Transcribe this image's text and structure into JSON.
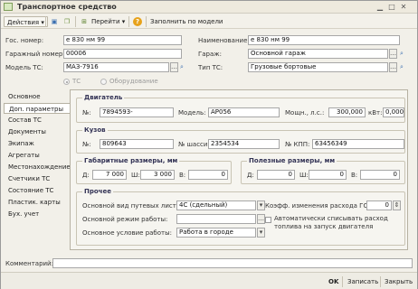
{
  "window": {
    "title": "Транспортное средство"
  },
  "toolbar": {
    "actions_label": "Действия",
    "goto_label": "Перейти",
    "help_label": "?",
    "fill_label": "Заполнить по модели"
  },
  "header": {
    "gos_nomer_label": "Гос. номер:",
    "gos_nomer_value": "е 830 нм 99",
    "naim_label": "Наименование:",
    "naim_value": "е 830 нм 99",
    "garage_num_label": "Гаражный номер:",
    "garage_num_value": "00006",
    "garage_label": "Гараж:",
    "garage_value": "Основной гараж",
    "model_label": "Модель ТС:",
    "model_value": "МАЗ-7916",
    "type_label": "Тип ТС:",
    "type_value": "Грузовые бортовые",
    "radio_ts": "ТС",
    "radio_equipment": "Оборудование"
  },
  "tabs": [
    {
      "label": "Основное"
    },
    {
      "label": "Доп. параметры"
    },
    {
      "label": "Состав ТС"
    },
    {
      "label": "Документы"
    },
    {
      "label": "Экипаж"
    },
    {
      "label": "Агрегаты"
    },
    {
      "label": "Местонахождение"
    },
    {
      "label": "Счетчики ТС"
    },
    {
      "label": "Состояние ТС"
    },
    {
      "label": "Пластик. карты"
    },
    {
      "label": "Бух. учет"
    }
  ],
  "engine": {
    "title": "Двигатель",
    "num_label": "№:",
    "num_value": "7894593-",
    "model_label": "Модель:",
    "model_value": "АР056",
    "power_label": "Мощн., л.с.:",
    "power_value": "300,000",
    "kw_label": "кВт:",
    "kw_value": "0,000"
  },
  "body": {
    "title": "Кузов",
    "num_label": "№:",
    "num_value": "809643",
    "chassis_label": "№ шасси:",
    "chassis_value": "2354534",
    "kpp_label": "№ КПП:",
    "kpp_value": "63456349"
  },
  "dims": {
    "title": "Габаритные размеры, мм",
    "d_label": "Д:",
    "d_value": "7 000",
    "w_label": "Ш:",
    "w_value": "3 000",
    "h_label": "В:",
    "h_value": "0"
  },
  "useful": {
    "title": "Полезные размеры, мм",
    "d_label": "Д:",
    "d_value": "0",
    "w_label": "Ш:",
    "w_value": "0",
    "h_label": "В:",
    "h_value": "0"
  },
  "other": {
    "title": "Прочее",
    "waybill_label": "Основной вид путевых листов:",
    "waybill_value": "4С (сдельный)",
    "mode_label": "Основной режим работы:",
    "mode_value": "",
    "cond_label": "Основное условие работы:",
    "cond_value": "Работа в городе",
    "coef_label": "Коэфф. изменения расхода ГСМ:",
    "coef_value": "0",
    "auto_label_1": "Автоматически списывать расход",
    "auto_label_2": "топлива на запуск двигателя"
  },
  "comment": {
    "label": "Комментарий:",
    "value": ""
  },
  "footer": {
    "ok_label": "OK",
    "save_label": "Записать",
    "close_label": "Закрыть"
  }
}
